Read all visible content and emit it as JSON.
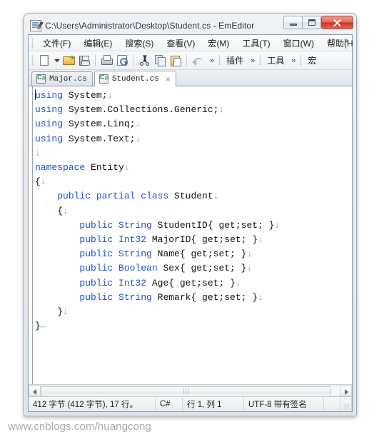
{
  "window": {
    "title": "C:\\Users\\Administrator\\Desktop\\Student.cs - EmEditor",
    "app_icon": "emeditor-document-icon",
    "caption": {
      "minimize": "minimize-button",
      "maximize": "maximize-button",
      "close": "close-button"
    }
  },
  "menubar": {
    "items": [
      {
        "label": "文件(F)"
      },
      {
        "label": "编辑(E)"
      },
      {
        "label": "搜索(S)"
      },
      {
        "label": "查看(V)"
      },
      {
        "label": "宏(M)"
      },
      {
        "label": "工具(T)"
      },
      {
        "label": "窗口(W)"
      },
      {
        "label": "帮助(H"
      }
    ],
    "overflow": "»"
  },
  "toolbar": {
    "buttons": [
      {
        "name": "new-file-icon",
        "kind": "icon"
      },
      {
        "name": "new-file-dropdown-arrow",
        "kind": "arrow"
      },
      {
        "name": "open-file-icon",
        "kind": "icon"
      },
      {
        "name": "save-file-icon",
        "kind": "icon"
      },
      {
        "name": "print-icon",
        "kind": "icon"
      },
      {
        "name": "print-preview-icon",
        "kind": "icon"
      },
      {
        "name": "cut-icon",
        "kind": "icon"
      },
      {
        "name": "copy-icon",
        "kind": "icon"
      },
      {
        "name": "paste-icon",
        "kind": "icon"
      },
      {
        "name": "undo-icon",
        "kind": "icon"
      }
    ],
    "overflow": "»",
    "groups": [
      {
        "label": "插件",
        "overflow": "»"
      },
      {
        "label": "工具",
        "overflow": "»"
      },
      {
        "label": "宏",
        "overflow": ""
      }
    ]
  },
  "tabs": [
    {
      "label": "Major.cs",
      "active": false,
      "closable": false
    },
    {
      "label": "Student.cs",
      "active": true,
      "closable": true,
      "close": "×"
    }
  ],
  "editor": {
    "language": "C#",
    "lines": [
      {
        "n": 1,
        "segments": [
          {
            "t": "using",
            "c": "kw"
          },
          {
            "t": " System;",
            "c": ""
          },
          {
            "t": "↓",
            "c": "cr"
          }
        ]
      },
      {
        "n": 2,
        "segments": [
          {
            "t": "using",
            "c": "kw"
          },
          {
            "t": " System.Collections.Generic;",
            "c": ""
          },
          {
            "t": "↓",
            "c": "cr"
          }
        ]
      },
      {
        "n": 3,
        "segments": [
          {
            "t": "using",
            "c": "kw"
          },
          {
            "t": " System.Linq;",
            "c": ""
          },
          {
            "t": "↓",
            "c": "cr"
          }
        ]
      },
      {
        "n": 4,
        "segments": [
          {
            "t": "using",
            "c": "kw"
          },
          {
            "t": " System.Text;",
            "c": ""
          },
          {
            "t": "↓",
            "c": "cr"
          }
        ]
      },
      {
        "n": 5,
        "segments": [
          {
            "t": "↓",
            "c": "cr"
          }
        ]
      },
      {
        "n": 6,
        "segments": [
          {
            "t": "namespace",
            "c": "kw"
          },
          {
            "t": " Entity",
            "c": ""
          },
          {
            "t": "↓",
            "c": "cr"
          }
        ]
      },
      {
        "n": 7,
        "segments": [
          {
            "t": "{",
            "c": ""
          },
          {
            "t": "↓",
            "c": "cr"
          }
        ]
      },
      {
        "n": 8,
        "segments": [
          {
            "t": "    ",
            "c": ""
          },
          {
            "t": "public partial class",
            "c": "kw"
          },
          {
            "t": " Student",
            "c": ""
          },
          {
            "t": "↓",
            "c": "cr"
          }
        ]
      },
      {
        "n": 9,
        "segments": [
          {
            "t": "    {",
            "c": ""
          },
          {
            "t": "↓",
            "c": "cr"
          }
        ]
      },
      {
        "n": 10,
        "segments": [
          {
            "t": "        ",
            "c": ""
          },
          {
            "t": "public String",
            "c": "kw"
          },
          {
            "t": " StudentID{ get;set; }",
            "c": ""
          },
          {
            "t": "↓",
            "c": "cr"
          }
        ]
      },
      {
        "n": 11,
        "segments": [
          {
            "t": "        ",
            "c": ""
          },
          {
            "t": "public Int32",
            "c": "kw"
          },
          {
            "t": " MajorID{ get;set; }",
            "c": ""
          },
          {
            "t": "↓",
            "c": "cr"
          }
        ]
      },
      {
        "n": 12,
        "segments": [
          {
            "t": "        ",
            "c": ""
          },
          {
            "t": "public String",
            "c": "kw"
          },
          {
            "t": " Name{ get;set; }",
            "c": ""
          },
          {
            "t": "↓",
            "c": "cr"
          }
        ]
      },
      {
        "n": 13,
        "segments": [
          {
            "t": "        ",
            "c": ""
          },
          {
            "t": "public Boolean",
            "c": "kw"
          },
          {
            "t": " Sex{ get;set; }",
            "c": ""
          },
          {
            "t": "↓",
            "c": "cr"
          }
        ]
      },
      {
        "n": 14,
        "segments": [
          {
            "t": "        ",
            "c": ""
          },
          {
            "t": "public Int32",
            "c": "kw"
          },
          {
            "t": " Age{ get;set; }",
            "c": ""
          },
          {
            "t": "↓",
            "c": "cr"
          }
        ]
      },
      {
        "n": 15,
        "segments": [
          {
            "t": "        ",
            "c": ""
          },
          {
            "t": "public String",
            "c": "kw"
          },
          {
            "t": " Remark{ get;set; }",
            "c": ""
          },
          {
            "t": "↓",
            "c": "cr"
          }
        ]
      },
      {
        "n": 16,
        "segments": [
          {
            "t": "    }",
            "c": ""
          },
          {
            "t": "↓",
            "c": "cr"
          }
        ]
      },
      {
        "n": 17,
        "segments": [
          {
            "t": "}",
            "c": ""
          },
          {
            "t": "←",
            "c": "cr"
          }
        ]
      }
    ],
    "caret_line": 1,
    "caret_col": 1
  },
  "scrollbar": {
    "left_arrow": "◄",
    "right_arrow": "►",
    "thumb_grip": "grip-dots"
  },
  "statusbar": {
    "size": "412 字节 (412 字节), 17 行。",
    "language": "C#",
    "position": "行 1, 列 1",
    "encoding": "UTF-8 带有签名",
    "extra": ""
  },
  "watermark": "www.cnblogs.com/huangcong",
  "colors": {
    "keyword": "#1b4fd8",
    "cr_mark": "#6fa8dc",
    "text": "#111111",
    "close_button": "#c8321c",
    "frame": "#dde3ea"
  }
}
